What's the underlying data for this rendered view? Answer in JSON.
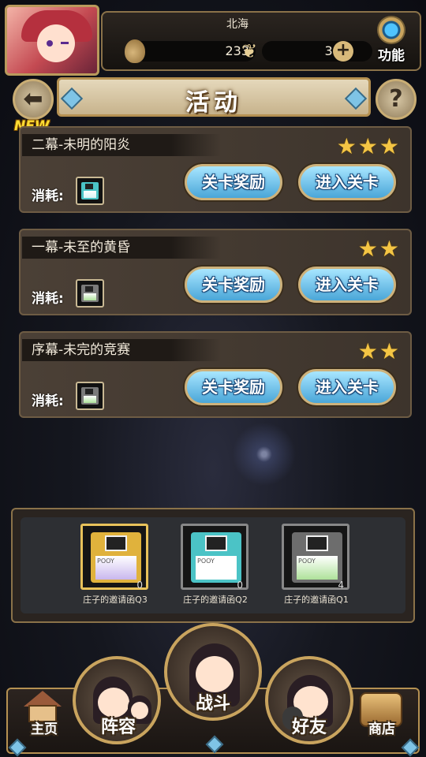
{
  "player": {
    "name": "北海",
    "currency1": "233",
    "currency2": "300"
  },
  "header": {
    "function_label": "功能",
    "title": "活动"
  },
  "new_badge": "NEW",
  "stages": [
    {
      "name": "二幕-未明的阳炎",
      "stars": "★★★",
      "cost_label": "消耗:",
      "reward_label": "关卡奖励",
      "enter_label": "进入关卡"
    },
    {
      "name": "一幕-未至的黄昏",
      "stars": "★★",
      "cost_label": "消耗:",
      "reward_label": "关卡奖励",
      "enter_label": "进入关卡"
    },
    {
      "name": "序幕-未完的竞赛",
      "stars": "★★",
      "cost_label": "消耗:",
      "reward_label": "关卡奖励",
      "enter_label": "进入关卡"
    }
  ],
  "inventory": [
    {
      "name": "庄子的邀请函Q3",
      "count": "0",
      "disk_label": "POOY",
      "color": "#e0b23c"
    },
    {
      "name": "庄子的邀请函Q2",
      "count": "0",
      "disk_label": "POOY",
      "color": "#4bc3c6"
    },
    {
      "name": "庄子的邀请函Q1",
      "count": "4",
      "disk_label": "POOY",
      "color": "#6d6d6d"
    }
  ],
  "nav": {
    "home": "主页",
    "lineup": "阵容",
    "battle": "战斗",
    "friends": "好友",
    "shop": "商店"
  },
  "colors": {
    "button_blue": "#4aa6d8",
    "star_gold": "#f4c544",
    "frame_gold": "#b59152"
  }
}
